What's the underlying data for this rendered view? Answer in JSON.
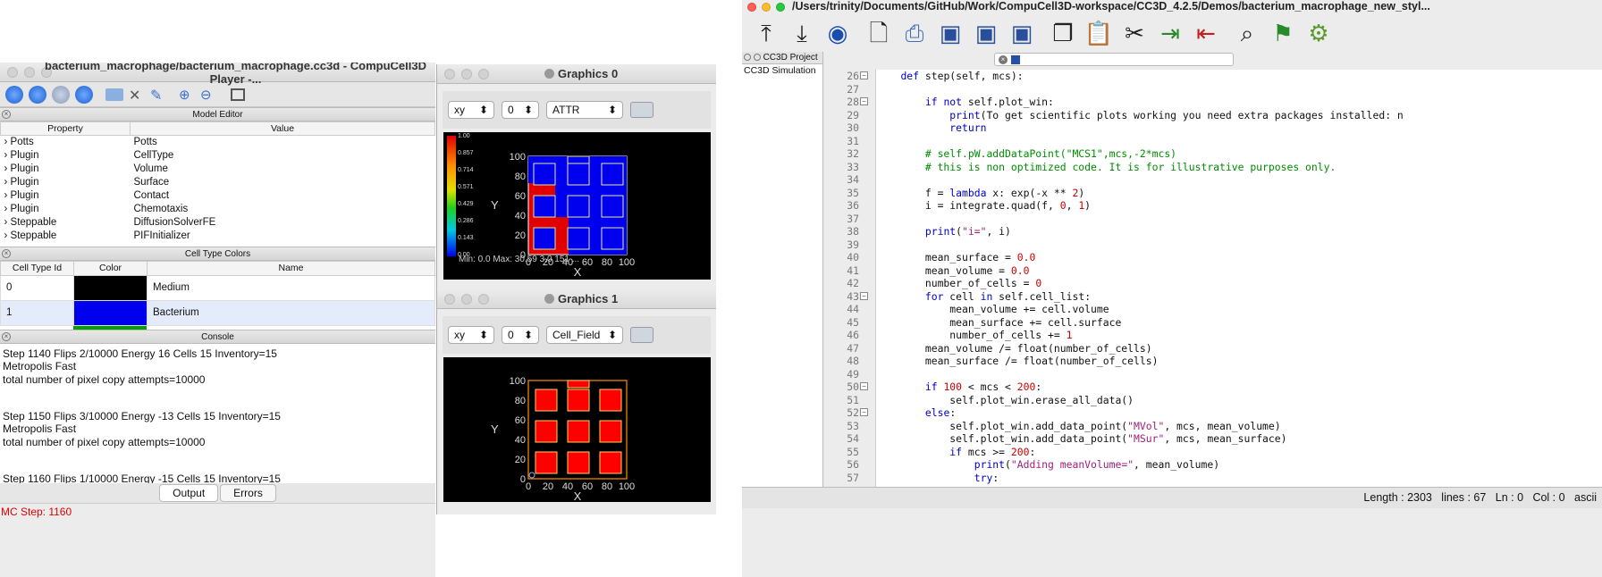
{
  "player": {
    "title": "bacterium_macrophage/bacterium_macrophage.cc3d - CompuCell3D Player -...",
    "model_editor": {
      "section": "Model Editor",
      "headers": [
        "Property",
        "Value"
      ],
      "rows": [
        [
          "Potts",
          "Potts"
        ],
        [
          "Plugin",
          "CellType"
        ],
        [
          "Plugin",
          "Volume"
        ],
        [
          "Plugin",
          "Surface"
        ],
        [
          "Plugin",
          "Contact"
        ],
        [
          "Plugin",
          "Chemotaxis"
        ],
        [
          "Steppable",
          "DiffusionSolverFE"
        ],
        [
          "Steppable",
          "PIFInitializer"
        ]
      ]
    },
    "cell_types": {
      "section": "Cell Type Colors",
      "headers": [
        "Cell Type Id",
        "Color",
        "Name"
      ],
      "rows": [
        {
          "id": "0",
          "color": "#000000",
          "name": "Medium"
        },
        {
          "id": "1",
          "color": "#0000ee",
          "name": "Bacterium"
        }
      ]
    },
    "console": {
      "section": "Console",
      "lines": [
        "Step 1140 Flips 2/10000 Energy 16 Cells 15 Inventory=15",
        "Metropolis Fast",
        "total number of pixel copy attempts=10000",
        "",
        "",
        "Step 1150 Flips 3/10000 Energy -13 Cells 15 Inventory=15",
        "Metropolis Fast",
        "total number of pixel copy attempts=10000",
        "",
        "",
        "Step 1160 Flips 1/10000 Energy -15 Cells 15 Inventory=15",
        "Metropolis Fast"
      ],
      "tabs": [
        "Output",
        "Errors"
      ]
    },
    "status": "MC Step: 1160"
  },
  "graphics0": {
    "title": "Graphics 0",
    "plane": "xy",
    "slice": "0",
    "field": "ATTR",
    "ylabel": "Y",
    "xlabel": "X",
    "ticks": [
      "0",
      "20",
      "40",
      "60",
      "80",
      "100"
    ],
    "legend_ticks": [
      "1.00",
      "0.857",
      "0.714",
      "0.571",
      "0.429",
      "0.286",
      "0.143",
      "0.00"
    ],
    "minmax": "Min: 0.0 Max: 30.59 3.0 151 ...",
    "colors": {
      "field": "#e00000",
      "cell": "#0000ee",
      "bg": "#000000"
    }
  },
  "graphics1": {
    "title": "Graphics 1",
    "plane": "xy",
    "slice": "0",
    "field": "Cell_Field",
    "ylabel": "Y",
    "xlabel": "X",
    "ticks": [
      "0",
      "20",
      "40",
      "60",
      "80",
      "100"
    ],
    "colors": {
      "cell": "#ff0000",
      "bg": "#000000"
    }
  },
  "editor": {
    "title": "/Users/trinity/Documents/GitHub/Work/CompuCell3D-workspace/CC3D_4.2.5/Demos/bacterium_macrophage_new_styl...",
    "toolbar_icons": [
      "upload-icon",
      "download-icon",
      "cc3d-logo-icon",
      "new-file-icon",
      "print-icon",
      "save-icon",
      "save-as-icon",
      "save-all-icon",
      "copy-icon",
      "paste-icon",
      "cut-icon",
      "indent-icon",
      "unindent-icon",
      "find-icon",
      "flag-icon",
      "settings-icon"
    ],
    "project_tab": "CC3D Project",
    "project_item": "CC3D Simulation",
    "status": "Length : 2303   lines : 67   Ln : 0   Col : 0   ascii",
    "line_numbers": [
      "26",
      "27",
      "28",
      "29",
      "30",
      "31",
      "32",
      "33",
      "34",
      "35",
      "36",
      "37",
      "38",
      "39",
      "40",
      "41",
      "42",
      "43",
      "44",
      "45",
      "46",
      "47",
      "48",
      "49",
      "50",
      "51",
      "52",
      "53",
      "54",
      "55",
      "56",
      "57"
    ],
    "code": [
      "    def step(self, mcs):",
      "",
      "        if not self.plot_win:",
      "            print(\"To get scientific plots working you need extra packages installed: n",
      "            return",
      "",
      "        # self.pW.addDataPoint(\"MCS1\",mcs,-2*mcs)",
      "        # this is non optimized code. It is for illustrative purposes only.",
      "",
      "        f = lambda x: exp(-x ** 2)",
      "        i = integrate.quad(f, 0, 1)",
      "",
      "        print(\"i=\", i)",
      "",
      "        mean_surface = 0.0",
      "        mean_volume = 0.0",
      "        number_of_cells = 0",
      "        for cell in self.cell_list:",
      "            mean_volume += cell.volume",
      "            mean_surface += cell.surface",
      "            number_of_cells += 1",
      "        mean_volume /= float(number_of_cells)",
      "        mean_surface /= float(number_of_cells)",
      "",
      "        if 100 < mcs < 200:",
      "            self.plot_win.erase_all_data()",
      "        else:",
      "            self.plot_win.add_data_point(\"MVol\", mcs, mean_volume)",
      "            self.plot_win.add_data_point(\"MSur\", mcs, mean_surface)",
      "            if mcs >= 200:",
      "                print(\"Adding meanVolume=\", mean_volume)",
      "                try:"
    ]
  }
}
